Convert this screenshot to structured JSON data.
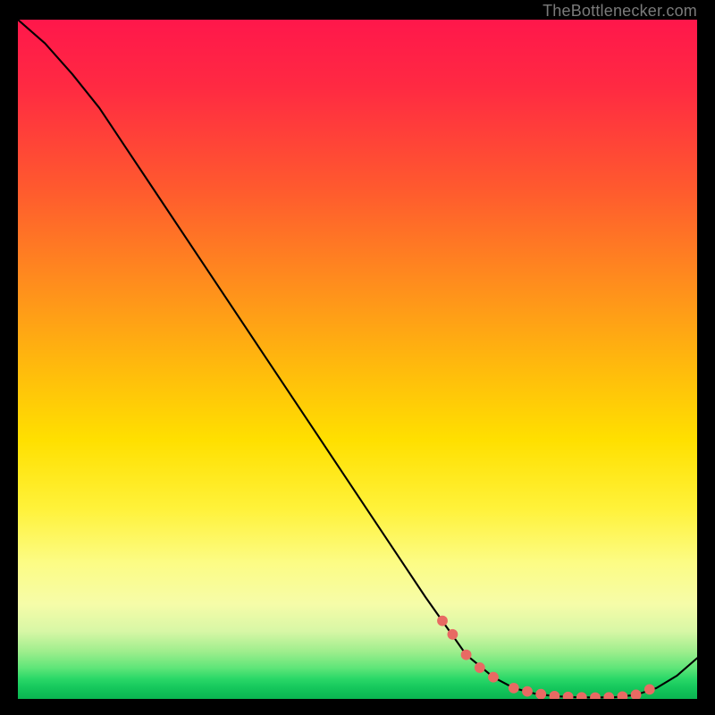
{
  "attribution": {
    "text": "TheBottlenecker.com"
  },
  "chart_data": {
    "type": "line",
    "title": "",
    "xlabel": "",
    "ylabel": "",
    "xlim": [
      0,
      100
    ],
    "ylim": [
      0,
      100
    ],
    "x": [
      0,
      4,
      8,
      12,
      16,
      20,
      28,
      36,
      44,
      52,
      60,
      66,
      70,
      73,
      76,
      79,
      82,
      85,
      88,
      91,
      94,
      97,
      100
    ],
    "values": [
      100,
      96.5,
      92,
      87,
      81,
      75,
      63,
      51,
      39,
      27,
      15,
      6.5,
      3.2,
      1.6,
      0.8,
      0.4,
      0.25,
      0.2,
      0.25,
      0.6,
      1.6,
      3.4,
      6.0
    ],
    "markers": {
      "x": [
        62.5,
        64,
        66,
        68,
        70,
        73,
        75,
        77,
        79,
        81,
        83,
        85,
        87,
        89,
        91,
        93
      ],
      "y": [
        11.5,
        9.5,
        6.5,
        4.6,
        3.2,
        1.6,
        1.1,
        0.7,
        0.4,
        0.3,
        0.22,
        0.2,
        0.22,
        0.35,
        0.6,
        1.4
      ],
      "color": "#e86a63",
      "size": 5.9
    },
    "line_color": "#000000",
    "line_width": 2.1
  }
}
